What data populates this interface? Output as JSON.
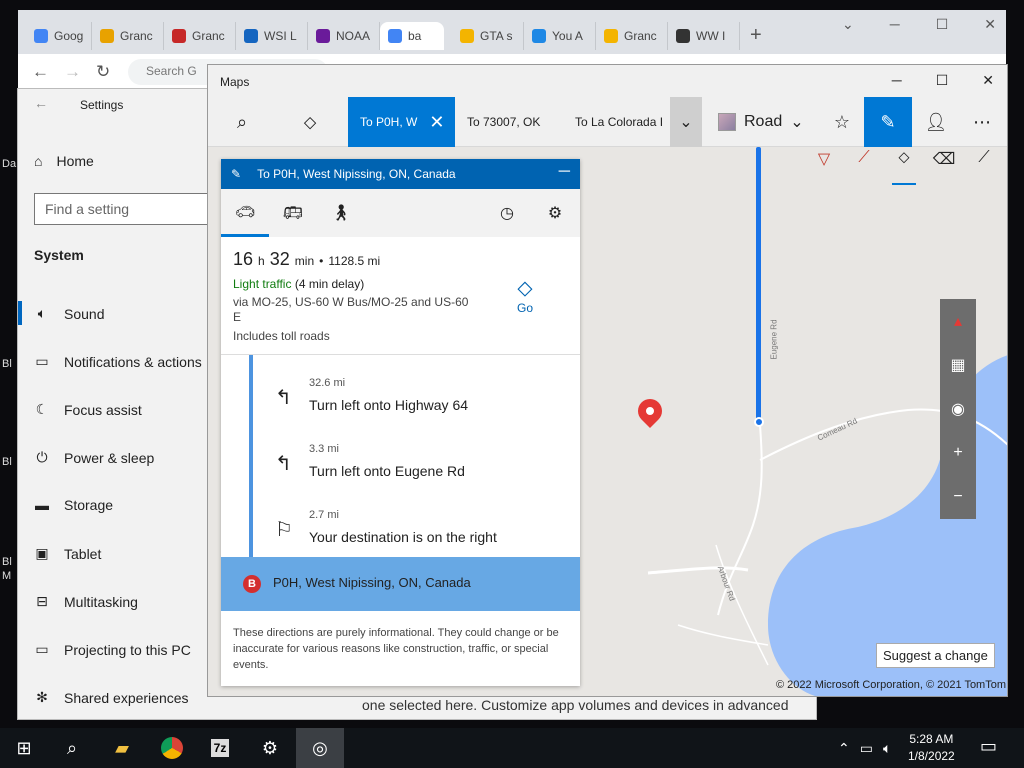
{
  "browser": {
    "tabs": [
      {
        "label": "Goog",
        "color": "#4285f4"
      },
      {
        "label": "Granc",
        "color": "#e8a200"
      },
      {
        "label": "Granc",
        "color": "#c62828"
      },
      {
        "label": "WSI L",
        "color": "#1565c0"
      },
      {
        "label": "NOAA",
        "color": "#6a1b9a"
      },
      {
        "label": "ba",
        "color": "#4285f4"
      },
      {
        "label": "GTA s",
        "color": "#f4b400"
      },
      {
        "label": "You A",
        "color": "#1e88e5"
      },
      {
        "label": "Granc",
        "color": "#f4b400"
      },
      {
        "label": "WW I",
        "color": "#333333"
      }
    ],
    "new_tab": "+",
    "omnibox_text": "Search G"
  },
  "settings": {
    "title": "Settings",
    "home": "Home",
    "search_placeholder": "Find a setting",
    "section": "System",
    "items": [
      {
        "label": "Sound",
        "icon": "speaker-icon"
      },
      {
        "label": "Notifications & actions",
        "icon": "notification-icon"
      },
      {
        "label": "Focus assist",
        "icon": "moon-icon"
      },
      {
        "label": "Power & sleep",
        "icon": "power-icon"
      },
      {
        "label": "Storage",
        "icon": "storage-icon"
      },
      {
        "label": "Tablet",
        "icon": "tablet-icon"
      },
      {
        "label": "Multitasking",
        "icon": "multitasking-icon"
      },
      {
        "label": "Projecting to this PC",
        "icon": "projecting-icon"
      },
      {
        "label": "Shared experiences",
        "icon": "shared-icon"
      }
    ],
    "bottom_text": "one selected here. Customize app volumes and devices in advanced"
  },
  "maps": {
    "title": "Maps",
    "route_tabs": [
      {
        "label": "To P0H, W",
        "active": true
      },
      {
        "label": "To 73007, OK",
        "active": false
      },
      {
        "label": "To La Colorada I",
        "active": false
      }
    ],
    "view_mode": "Road",
    "road_labels": {
      "eugene": "Eugene Rd",
      "comeau": "Comeau Rd",
      "arbour": "Arbour Rd"
    },
    "suggest_label": "Suggest a change",
    "copyright": "© 2022 Microsoft Corporation, © 2021 TomTom"
  },
  "directions": {
    "header": "To P0H, West Nipissing, ON, Canada",
    "duration_h": "16",
    "duration_m": "32",
    "h_unit": "h",
    "min_unit": "min",
    "distance": "1128.5 mi",
    "traffic_status": "Light traffic",
    "traffic_delay": "(4 min delay)",
    "via": "via MO-25, US-60 W Bus/MO-25 and US-60 E",
    "tolls": "Includes toll roads",
    "go_label": "Go",
    "steps": [
      {
        "distance": "32.6 mi",
        "instruction": "Turn left onto Highway 64",
        "icon": "turn-left-icon"
      },
      {
        "distance": "3.3 mi",
        "instruction": "Turn left onto Eugene Rd",
        "icon": "turn-left-icon"
      },
      {
        "distance": "2.7 mi",
        "instruction": "Your destination is on the right",
        "icon": "flag-icon"
      }
    ],
    "destination_marker": "B",
    "destination": "P0H, West Nipissing, ON, Canada",
    "disclaimer": "These directions are purely informational. They could change or be inaccurate for various reasons like construction, traffic, or special events."
  },
  "taskbar": {
    "time": "5:28 AM",
    "date": "1/8/2022",
    "apps": [
      "start-icon",
      "search-icon",
      "file-explorer-icon",
      "chrome-icon",
      "7zip-icon",
      "settings-icon",
      "maps-icon"
    ],
    "zip_label": "7z"
  },
  "desktop": {
    "icon_labels": [
      "Da",
      "Bl",
      "Bl",
      "Bl",
      "M"
    ]
  }
}
